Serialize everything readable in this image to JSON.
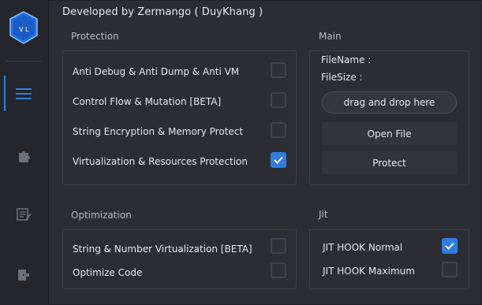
{
  "app": {
    "title": "Developed by Zermango ( DuyKhang )",
    "logo_letters": [
      "V",
      "L"
    ]
  },
  "sidebar": {
    "items": [
      {
        "name": "menu",
        "icon": "hamburger-menu-icon",
        "active": true
      },
      {
        "name": "plugins",
        "icon": "puzzle-icon",
        "active": false
      },
      {
        "name": "notes",
        "icon": "edit-document-icon",
        "active": false
      },
      {
        "name": "exit",
        "icon": "exit-icon",
        "active": false
      }
    ]
  },
  "protection": {
    "label": "Protection",
    "options": [
      {
        "label": "Anti Debug & Anti Dump & Anti VM",
        "checked": false
      },
      {
        "label": "Control Flow & Mutation [BETA]",
        "checked": false
      },
      {
        "label": "String Encryption & Memory Protect",
        "checked": false
      },
      {
        "label": "Virtualization & Resources Protection",
        "checked": true
      }
    ]
  },
  "main": {
    "label": "Main",
    "filename_label": "FileName :",
    "filesize_label": "FileSize :",
    "drop_label": "drag and drop here",
    "open_label": "Open File",
    "protect_label": "Protect"
  },
  "optimization": {
    "label": "Optimization",
    "options": [
      {
        "label": "String & Number Virtualization [BETA]",
        "checked": false
      },
      {
        "label": "Optimize Code",
        "checked": false
      }
    ]
  },
  "jit": {
    "label": "Jit",
    "options": [
      {
        "label": "JIT HOOK Normal",
        "checked": true
      },
      {
        "label": "JIT HOOK Maximum",
        "checked": false
      }
    ]
  },
  "colors": {
    "accent": "#2f7de1",
    "background": "#2b2d32",
    "sidebar": "#24262b",
    "border": "#3a3d44"
  }
}
